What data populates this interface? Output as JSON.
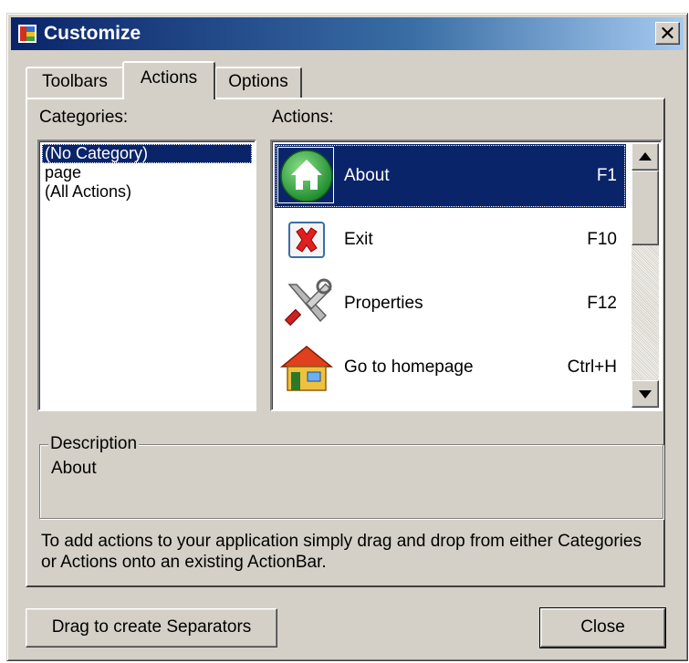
{
  "window": {
    "title": "Customize",
    "close_glyph": "✕"
  },
  "tabs": [
    {
      "label": "Toolbars",
      "active": false
    },
    {
      "label": "Actions",
      "active": true
    },
    {
      "label": "Options",
      "active": false
    }
  ],
  "categories": {
    "label": "Categories:",
    "items": [
      "(No Category)",
      "page",
      "(All Actions)"
    ],
    "selected_index": 0
  },
  "actions": {
    "label": "Actions:",
    "items": [
      {
        "name": "About",
        "shortcut": "F1",
        "icon": "home-circle-icon"
      },
      {
        "name": "Exit",
        "shortcut": "F10",
        "icon": "red-x-icon"
      },
      {
        "name": "Properties",
        "shortcut": "F12",
        "icon": "wrench-screwdriver-icon"
      },
      {
        "name": "Go to homepage",
        "shortcut": "Ctrl+H",
        "icon": "house-icon"
      }
    ],
    "selected_index": 0
  },
  "description": {
    "title": "Description",
    "text": "About"
  },
  "help_text": "To add actions to your application simply drag and drop from either Categories or Actions onto an existing ActionBar.",
  "buttons": {
    "separators": "Drag to create Separators",
    "close": "Close"
  },
  "colors": {
    "selection": "#0a246a",
    "face": "#d4d0c8"
  }
}
